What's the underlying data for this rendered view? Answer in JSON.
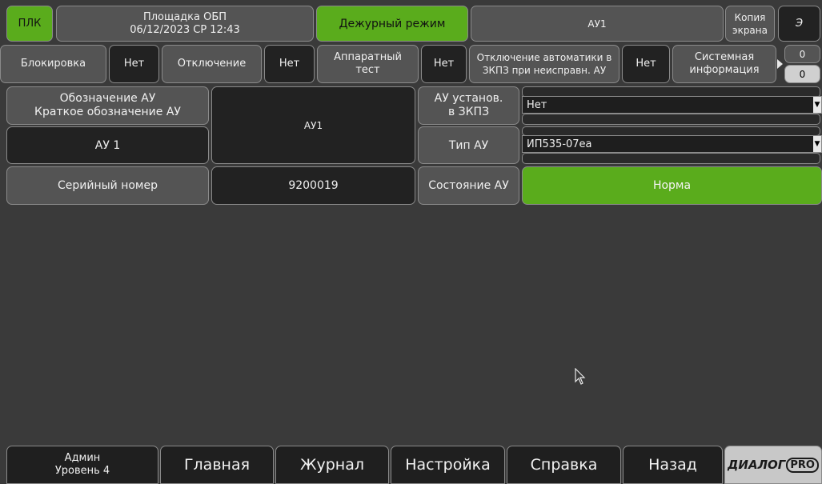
{
  "top": {
    "plc": "ПЛК",
    "site_line1": "Площадка ОБП",
    "site_line2": "06/12/2023 СР 12:43",
    "mode": "Дежурный режим",
    "device": "АУ1",
    "copy_line1": "Копия",
    "copy_line2": "экрана",
    "e_label": "Э"
  },
  "status": {
    "block_label": "Блокировка",
    "block_value": "Нет",
    "disable_label": "Отключение",
    "disable_value": "Нет",
    "hwtest_line1": "Аппаратный",
    "hwtest_line2": "тест",
    "hwtest_value": "Нет",
    "auto_off_line1": "Отключение автоматики в",
    "auto_off_line2": "ЗКПЗ при неисправн. АУ",
    "auto_off_value": "Нет",
    "sysinfo_line1": "Системная",
    "sysinfo_line2": "информация",
    "counter1": "0",
    "counter2": "0"
  },
  "form": {
    "designation_line1": "Обозначение АУ",
    "designation_line2": "Краткое обозначение АУ",
    "name_value": "АУ1",
    "short_value": "АУ 1",
    "installed_line1": "АУ установ.",
    "installed_line2": "в ЗКПЗ",
    "installed_select": "Нет",
    "type_label": "Тип АУ",
    "type_select": "ИП535-07еа",
    "serial_label": "Серийный номер",
    "serial_value": "9200019",
    "state_label": "Состояние АУ",
    "state_value": "Норма"
  },
  "nav": {
    "user_line1": "Админ",
    "user_line2": "Уровень 4",
    "home": "Главная",
    "journal": "Журнал",
    "settings": "Настройка",
    "help": "Справка",
    "back": "Назад",
    "logo_main": "ДИАЛОГ",
    "logo_suffix": "PRO"
  },
  "colors": {
    "green": "#5aac1c",
    "dark": "#222222",
    "grey": "#545454",
    "background": "#3a3a3a"
  }
}
